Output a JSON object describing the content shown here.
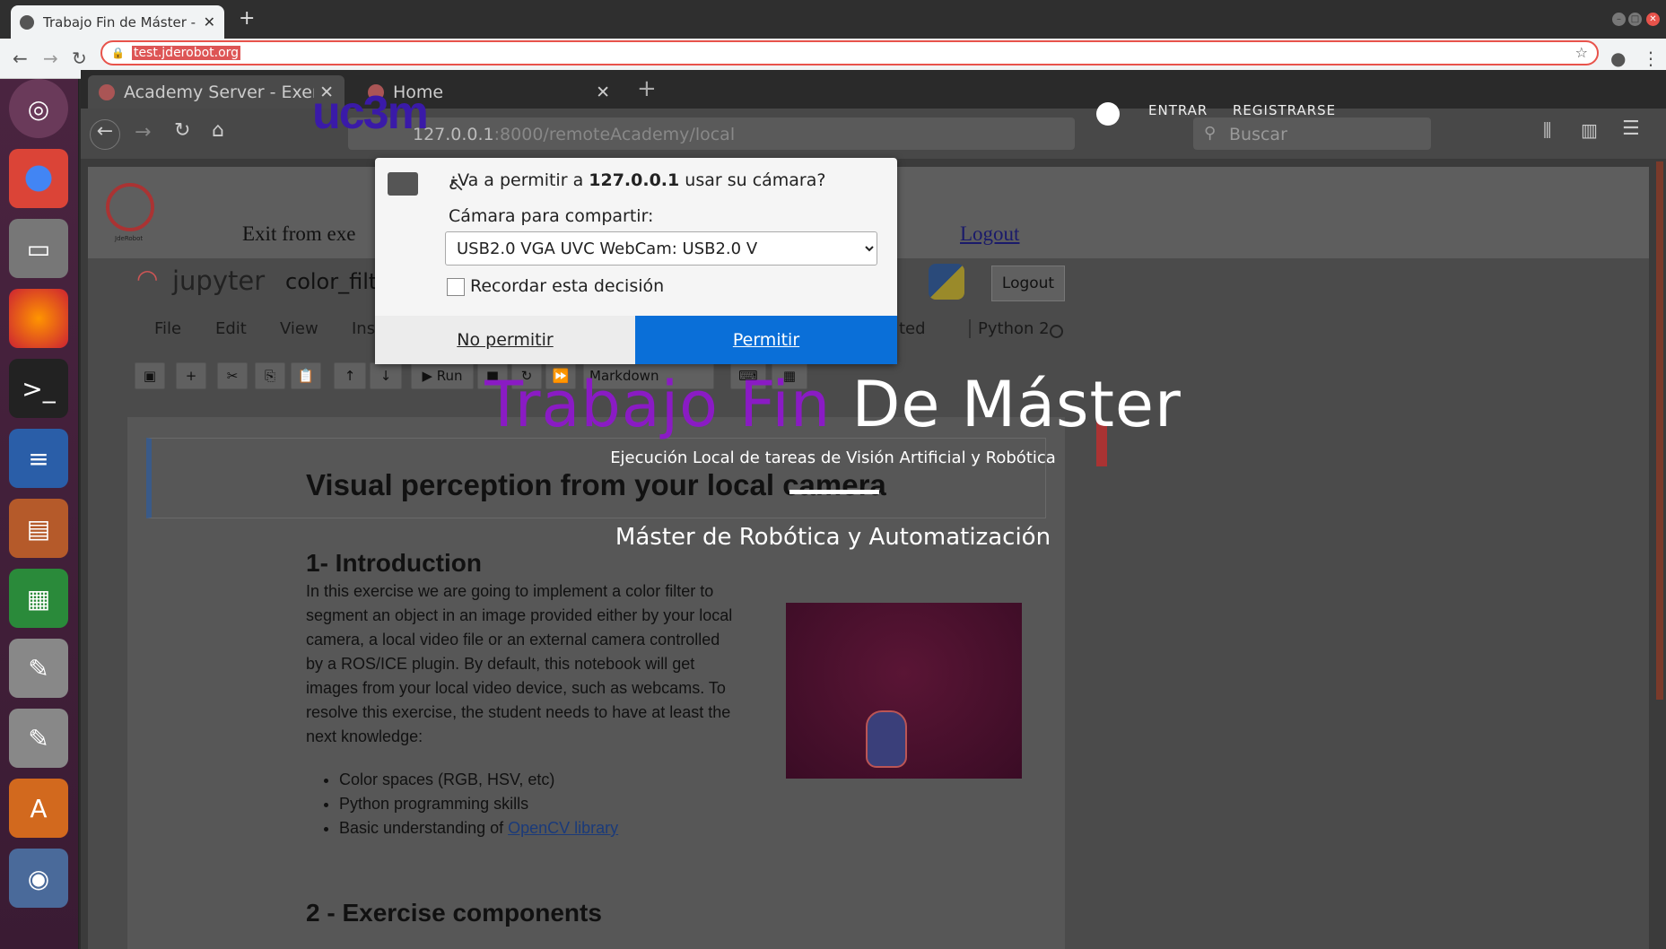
{
  "chrome": {
    "tab_title": "Trabajo Fin de Máster - Ca",
    "url": "test.jderobot.org"
  },
  "firefox": {
    "tab1": "Academy Server - Exerci",
    "tab2": "Home",
    "url_host": "127.0.0.1",
    "url_rest": ":8000/remoteAcademy/local",
    "search_placeholder": "Buscar"
  },
  "jde": {
    "exit_text": "Exit from exe",
    "logout_link": "Logout",
    "logo_caption": "JdeRobot"
  },
  "jupyter": {
    "brand": "jupyter",
    "notebook_name": "color_filt",
    "logout": "Logout",
    "menu": [
      "File",
      "Edit",
      "View",
      "Ins"
    ],
    "trusted": "ted",
    "kernel": "Python 2",
    "run": "Run",
    "cell_type": "Markdown"
  },
  "notebook": {
    "title": "Visual perception from your local camera",
    "h1": "1- Introduction",
    "intro_lines": [
      "In this exercise we are going to implement a color filter to",
      "segment an object in an image provided either by your local",
      "camera, a local video file or an external camera controlled",
      "by a ROS/ICE plugin. By default, this notebook will get",
      "images from your local video device, such as webcams. To",
      "resolve this exercise, the student needs to have at least the",
      "next knowledge:"
    ],
    "bullets": [
      "Color spaces (RGB, HSV, etc)",
      "Python programming skills",
      "Basic understanding of "
    ],
    "opencv_link": "OpenCV library",
    "h2": "2 - Exercise components"
  },
  "hero": {
    "uc3m": "uc3m",
    "nav_enter": "ENTRAR",
    "nav_register": "REGISTRARSE",
    "title_purple": "Trabajo Fin",
    "title_white": "De Máster",
    "subtitle": "Ejecución Local de tareas de Visión Artificial y Robótica",
    "master": "Máster de Robótica y Automatización"
  },
  "dialog": {
    "question_pre": "¿Va a permitir a ",
    "question_host": "127.0.0.1",
    "question_post": " usar su cámara?",
    "camera_label": "Cámara para compartir:",
    "camera_selected": "USB2.0 VGA UVC WebCam: USB2.0 V",
    "remember": "Recordar esta decisión",
    "deny": "No permitir",
    "allow": "Permitir"
  },
  "colors": {
    "accent_purple": "#8a1bc4",
    "allow_blue": "#0a6fd8",
    "omnibox_border": "#e8534b"
  }
}
